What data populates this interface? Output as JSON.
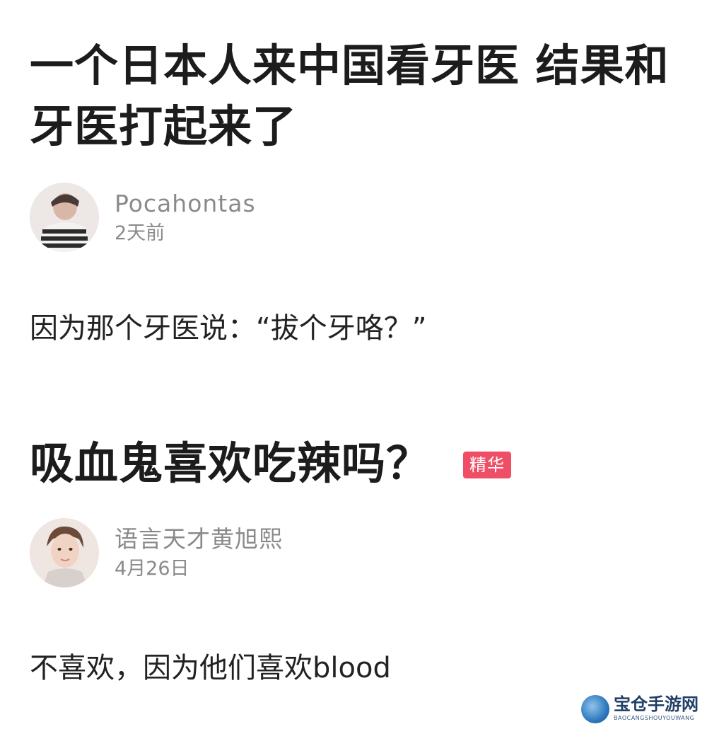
{
  "posts": [
    {
      "title": "一个日本人来中国看牙医 结果和牙医打起来了",
      "author": {
        "name": "Pocahontas",
        "time": "2天前",
        "avatar_icon": "user-avatar-photo"
      },
      "body": "因为那个牙医说：“拔个牙咯？”"
    },
    {
      "title": "吸血鬼喜欢吃辣吗？",
      "badge": "精华",
      "author": {
        "name": "语言天才黄旭熙",
        "time": "4月26日",
        "avatar_icon": "user-avatar-photo"
      },
      "body": "不喜欢，因为他们喜欢blood"
    }
  ],
  "watermark": {
    "title": "宝仓手游网",
    "subtitle": "BAOCANGSHOUYOUWANG",
    "icon": "site-logo-icon"
  },
  "colors": {
    "badge": "#ef4f66",
    "meta_text": "#8a8a8a",
    "title_text": "#1c1c1c"
  }
}
